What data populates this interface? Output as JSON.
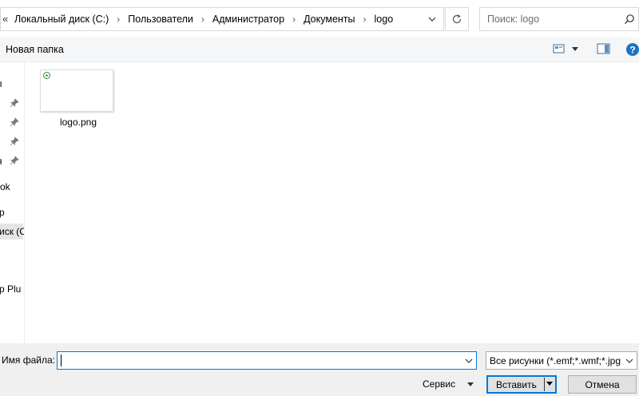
{
  "address": {
    "overflow_glyph": "«",
    "breadcrumbs": [
      "Локальный диск (C:)",
      "Пользователи",
      "Администратор",
      "Документы",
      "logo"
    ]
  },
  "search": {
    "placeholder": "Поиск: logo"
  },
  "toolbar": {
    "new_folder": "Новая папка",
    "help": "?"
  },
  "nav": {
    "items": [
      {
        "label": "п",
        "pinned": false,
        "selected": false
      },
      {
        "label": "",
        "pinned": true,
        "selected": false
      },
      {
        "label": "",
        "pinned": true,
        "selected": false
      },
      {
        "label": "",
        "pinned": true,
        "selected": false
      },
      {
        "label": "я",
        "pinned": true,
        "selected": false
      },
      {
        "label": "ok",
        "pinned": false,
        "selected": false
      },
      {
        "label": "р",
        "pinned": false,
        "selected": false
      },
      {
        "label": "иск (С",
        "pinned": false,
        "selected": true
      },
      {
        "label": "p Plu",
        "pinned": false,
        "selected": false
      }
    ]
  },
  "files": [
    {
      "name": "logo.png"
    }
  ],
  "bottom": {
    "filename_label": "Имя файла:",
    "filename_value": "",
    "filetype_value": "Все рисунки (*.emf;*.wmf;*.jpg",
    "tools_label": "Сервис",
    "insert_label": "Вставить",
    "cancel_label": "Отмена"
  },
  "colors": {
    "accent": "#0078d7",
    "help": "#1a73c8"
  }
}
